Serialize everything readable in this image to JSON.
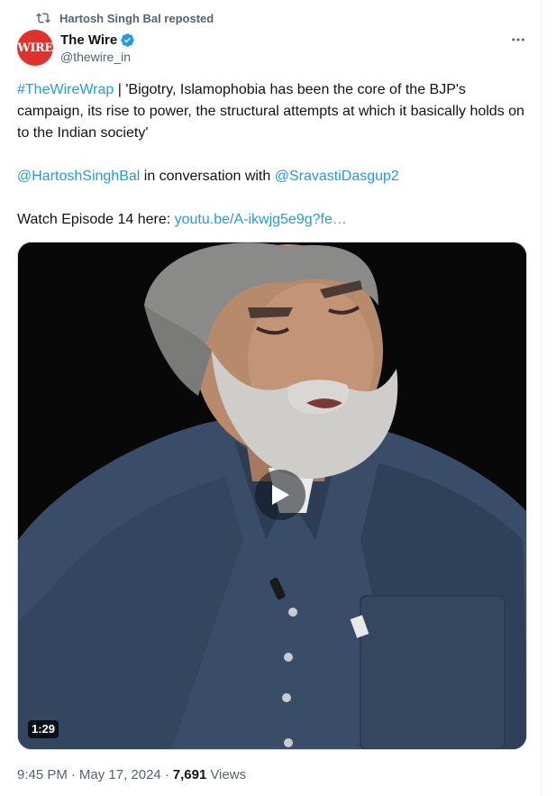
{
  "repost": {
    "text": "Hartosh Singh Bal reposted",
    "icon": "repost-icon"
  },
  "author": {
    "name": "The Wire",
    "handle": "@thewire_in",
    "avatar_logo": "WIRE",
    "verified": true
  },
  "tweet": {
    "hashtag": "#TheWireWrap",
    "line1_rest": " | 'Bigotry, Islamophobia has been the core of the BJP's campaign, its rise to power, the structural attempts at which it basically holds on to the Indian society'",
    "mention1": "@HartoshSinghBal",
    "conversation_text": " in conversation with ",
    "mention2": "@SravastiDasgup2",
    "watch_text": "Watch Episode 14 here: ",
    "watch_link": "youtu.be/A-ikwjg5e9g?fe…"
  },
  "video": {
    "duration": "1:29"
  },
  "meta": {
    "time": "9:45 PM",
    "separator": "·",
    "date": "May 17, 2024",
    "views_count": "7,691",
    "views_label": "Views"
  },
  "colors": {
    "link": "#1d9bf0",
    "secondary": "#536471",
    "text": "#0f1419",
    "verified": "#1d9bf0",
    "avatar_bg": "#e0312b"
  }
}
